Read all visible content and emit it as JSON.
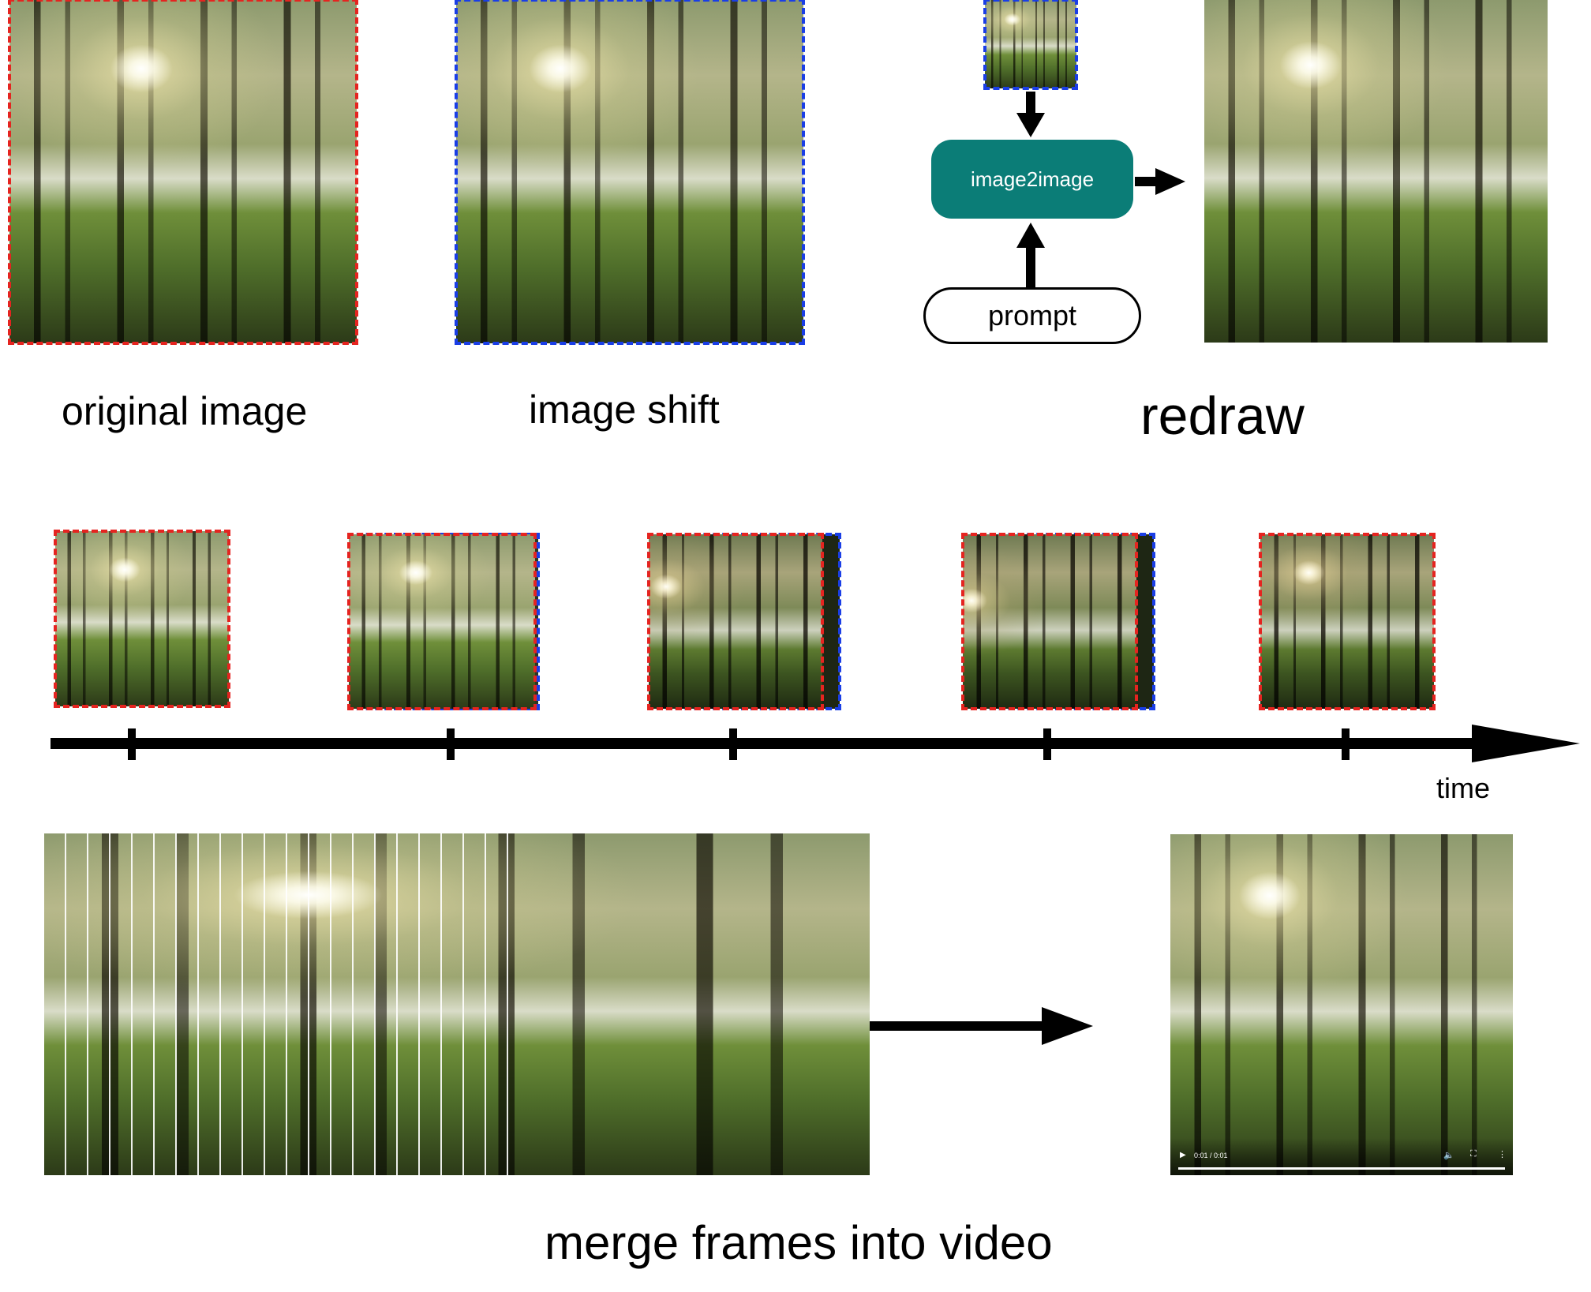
{
  "labels": {
    "original": "original image",
    "shift": "image shift",
    "redraw": "redraw",
    "time": "time",
    "merge": "merge frames into video"
  },
  "redraw_flow": {
    "model": "image2image",
    "prompt": "prompt"
  },
  "video_player": {
    "time": "0:01 / 0:01"
  },
  "colors": {
    "original_border": "#e52420",
    "shift_border": "#1a3ee6",
    "model_node": "#0b7d77"
  }
}
